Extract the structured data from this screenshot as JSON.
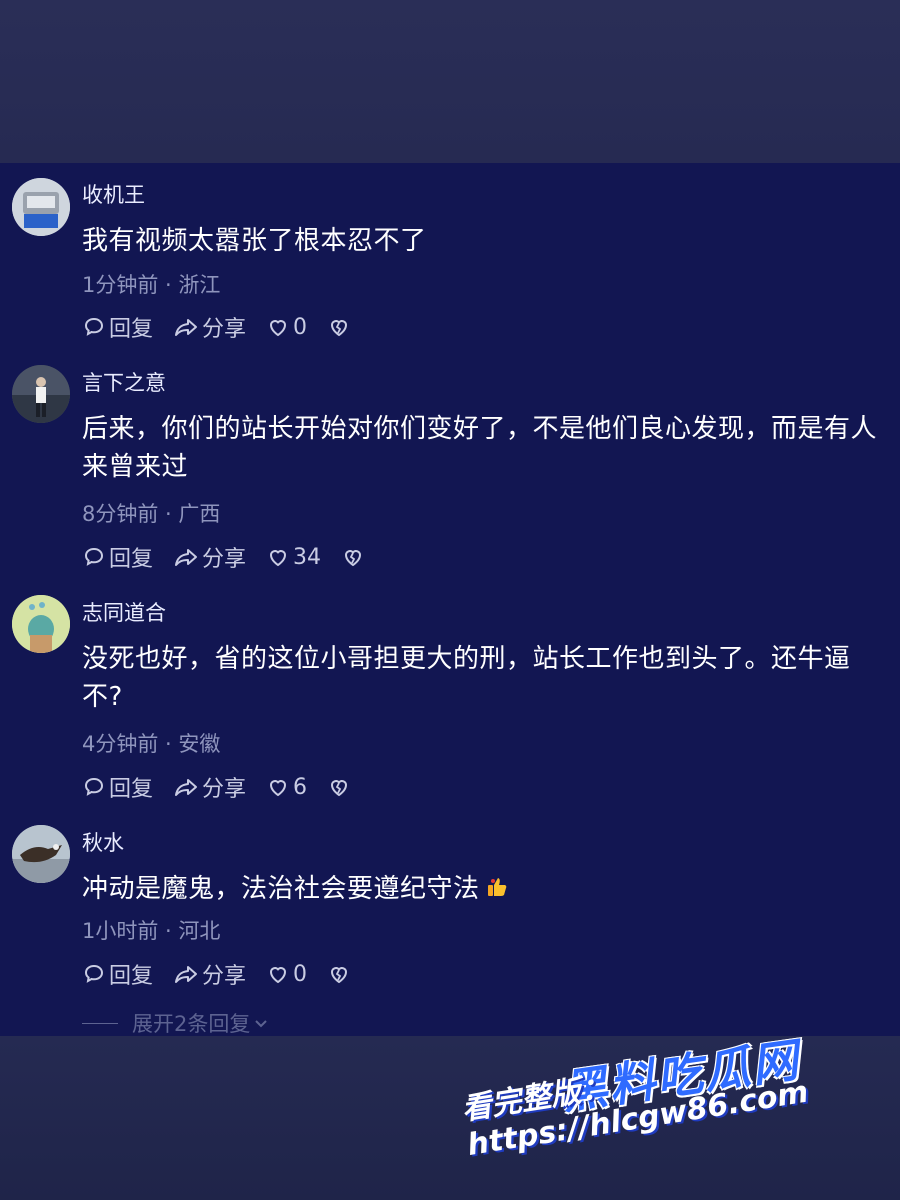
{
  "comments": [
    {
      "username": "收机王",
      "text": "我有视频太嚣张了根本忍不了",
      "meta": "1分钟前 · 浙江",
      "reply_label": "回复",
      "share_label": "分享",
      "likes": "0",
      "avatar_icon": "scale-avatar"
    },
    {
      "username": "言下之意",
      "text": "后来，你们的站长开始对你们变好了，不是他们良心发现，而是有人来曾来过",
      "meta": "8分钟前 · 广西",
      "reply_label": "回复",
      "share_label": "分享",
      "likes": "34",
      "avatar_icon": "person-avatar"
    },
    {
      "username": "志同道合",
      "text": "没死也好，省的这位小哥担更大的刑，站长工作也到头了。还牛逼不?",
      "meta": "4分钟前 · 安徽",
      "reply_label": "回复",
      "share_label": "分享",
      "likes": "6",
      "avatar_icon": "cactus-avatar"
    },
    {
      "username": "秋水",
      "text": "冲动是魔鬼，法治社会要遵纪守法",
      "meta": "1小时前 · 河北",
      "reply_label": "回复",
      "share_label": "分享",
      "likes": "0",
      "avatar_icon": "eagle-avatar"
    }
  ],
  "expand_replies_label": "展开2条回复",
  "watermark": {
    "title": "黑料吃瓜网",
    "url": "看完整版：https://hlcgw86.com"
  },
  "colors": {
    "panel_bg": "#121652",
    "text": "#ffffff",
    "meta": "#8f95bd",
    "watermark_blue": "#2f6bff"
  }
}
